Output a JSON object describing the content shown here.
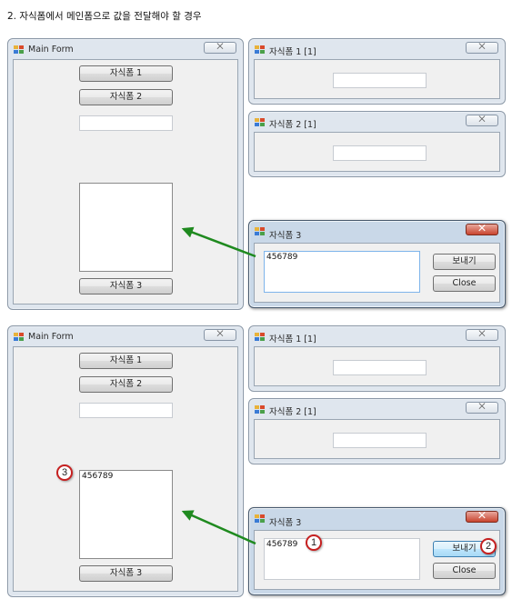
{
  "heading": "2. 자식폼에서 메인폼으로 값을 전달해야 할 경우",
  "colors": {
    "arrow": "#1f8a1f",
    "callout_border": "#c62020",
    "active_close": "#c9452f"
  },
  "top": {
    "main_form": {
      "title": "Main Form",
      "close_glyph": "⨉",
      "button1": "자식폼 1",
      "button2": "자식폼 2",
      "textbox_value": "",
      "listbox_text": "",
      "button3": "자식폼 3"
    },
    "child1": {
      "title": "자식폼 1 [1]",
      "close_glyph": "⨉",
      "textbox_value": ""
    },
    "child2": {
      "title": "자식폼 2 [1]",
      "close_glyph": "⨉",
      "textbox_value": ""
    },
    "child3": {
      "title": "자식폼 3",
      "close_glyph": "⨉",
      "textbox_value": "456789",
      "send_label": "보내기",
      "close_label": "Close"
    }
  },
  "bottom": {
    "main_form": {
      "title": "Main Form",
      "close_glyph": "⨉",
      "button1": "자식폼 1",
      "button2": "자식폼 2",
      "textbox_value": "",
      "listbox_text": "456789",
      "button3": "자식폼 3"
    },
    "child1": {
      "title": "자식폼 1 [1]",
      "close_glyph": "⨉",
      "textbox_value": ""
    },
    "child2": {
      "title": "자식폼 2 [1]",
      "close_glyph": "⨉",
      "textbox_value": ""
    },
    "child3": {
      "title": "자식폼 3",
      "close_glyph": "⨉",
      "textbox_value": "456789",
      "send_label": "보내기",
      "close_label": "Close"
    },
    "callouts": [
      "1",
      "2",
      "3"
    ]
  },
  "icons": {
    "app": "winforms-app-icon",
    "arrow": "green-arrow-icon"
  }
}
